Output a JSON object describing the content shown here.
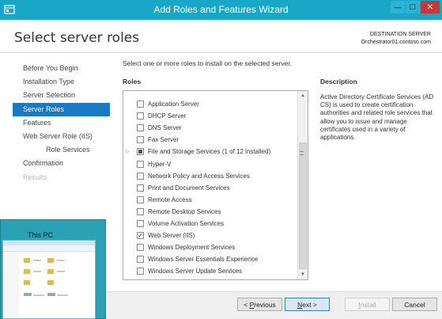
{
  "window": {
    "title": "Add Roles and Features Wizard",
    "controls": {
      "minimize": "—",
      "maximize": "□",
      "close": "✕"
    }
  },
  "header": {
    "page_title": "Select server roles",
    "destination_label": "DESTINATION SERVER",
    "destination_server": "Orchestrator01.contoso.com"
  },
  "nav": {
    "items": [
      {
        "label": "Before You Begin",
        "state": "normal"
      },
      {
        "label": "Installation Type",
        "state": "normal"
      },
      {
        "label": "Server Selection",
        "state": "normal"
      },
      {
        "label": "Server Roles",
        "state": "active"
      },
      {
        "label": "Features",
        "state": "normal"
      },
      {
        "label": "Web Server Role (IIS)",
        "state": "normal"
      },
      {
        "label": "Role Services",
        "state": "normal"
      },
      {
        "label": "Confirmation",
        "state": "normal"
      },
      {
        "label": "Results",
        "state": "disabled"
      }
    ]
  },
  "main": {
    "instruction": "Select one or more roles to install on the selected server.",
    "roles_heading": "Roles",
    "roles": [
      {
        "label": "Application Server",
        "checked": false
      },
      {
        "label": "DHCP Server",
        "checked": false
      },
      {
        "label": "DNS Server",
        "checked": false
      },
      {
        "label": "Fax Server",
        "checked": false
      },
      {
        "label": "File and Storage Services (1 of 12 installed)",
        "checked": "partial",
        "expandable": true
      },
      {
        "label": "Hyper-V",
        "checked": false
      },
      {
        "label": "Network Policy and Access Services",
        "checked": false
      },
      {
        "label": "Print and Document Services",
        "checked": false
      },
      {
        "label": "Remote Access",
        "checked": false
      },
      {
        "label": "Remote Desktop Services",
        "checked": false
      },
      {
        "label": "Volume Activation Services",
        "checked": false
      },
      {
        "label": "Web Server (IIS)",
        "checked": true
      },
      {
        "label": "Windows Deployment Services",
        "checked": false
      },
      {
        "label": "Windows Server Essentials Experience",
        "checked": false
      },
      {
        "label": "Windows Server Update Services",
        "checked": false
      }
    ],
    "description_heading": "Description",
    "description_text": "Active Directory Certificate Services (AD CS) is used to create certification authorities and related role services that allow you to issue and manage certificates used in a variety of applications."
  },
  "footer": {
    "previous": {
      "prefix": "< ",
      "mnemonic": "P",
      "rest": "revious"
    },
    "next": {
      "mnemonic": "N",
      "rest": "ext >"
    },
    "install": {
      "mnemonic": "I",
      "rest": "nstall"
    },
    "cancel": "Cancel"
  },
  "thumbnail": {
    "title": "This PC"
  },
  "colors": {
    "titlebar": "#19a7c8",
    "nav_active": "#1979c4",
    "close_button": "#c7383a",
    "thumbnail_bg": "#2ba1b6"
  }
}
